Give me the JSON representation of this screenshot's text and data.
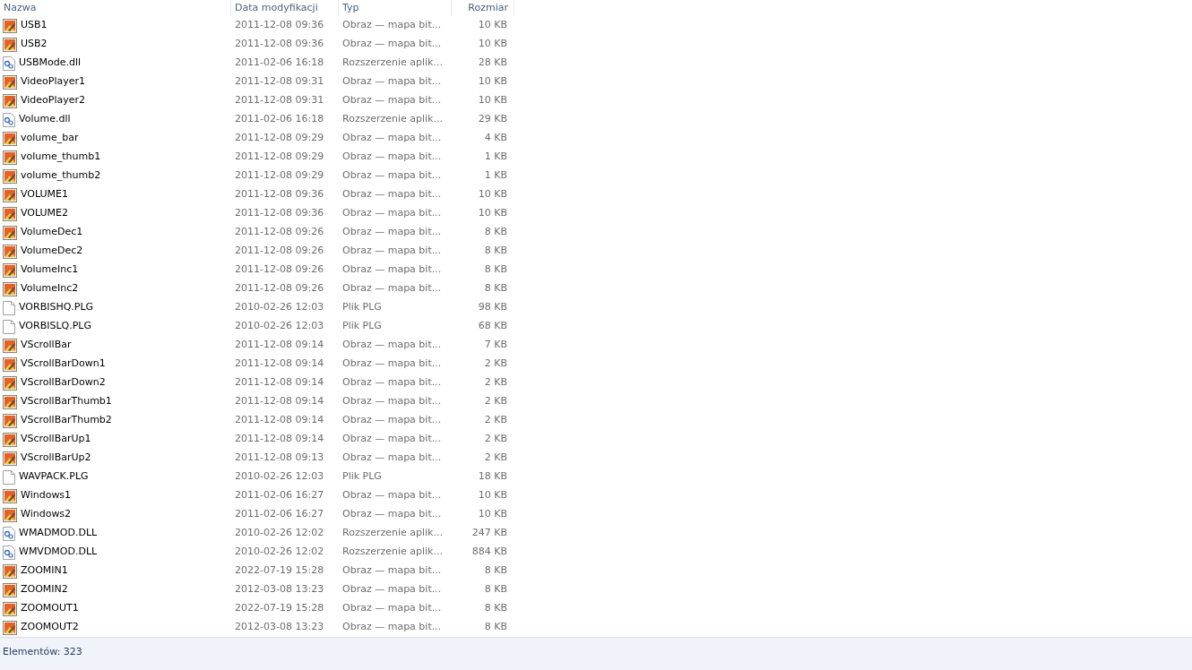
{
  "columns": [
    "Nazwa",
    "Data modyfikacji",
    "Typ",
    "Rozmiar"
  ],
  "files": [
    {
      "name": "USB1",
      "date": "2011-12-08 09:36",
      "type": "Obraz — mapa bit...",
      "size": "10 KB",
      "kind": "bitmap"
    },
    {
      "name": "USB2",
      "date": "2011-12-08 09:36",
      "type": "Obraz — mapa bit...",
      "size": "10 KB",
      "kind": "bitmap"
    },
    {
      "name": "USBMode.dll",
      "date": "2011-02-06 16:18",
      "type": "Rozszerzenie aplik...",
      "size": "28 KB",
      "kind": "dll"
    },
    {
      "name": "VideoPlayer1",
      "date": "2011-12-08 09:31",
      "type": "Obraz — mapa bit...",
      "size": "10 KB",
      "kind": "bitmap"
    },
    {
      "name": "VideoPlayer2",
      "date": "2011-12-08 09:31",
      "type": "Obraz — mapa bit...",
      "size": "10 KB",
      "kind": "bitmap"
    },
    {
      "name": "Volume.dll",
      "date": "2011-02-06 16:18",
      "type": "Rozszerzenie aplik...",
      "size": "29 KB",
      "kind": "dll"
    },
    {
      "name": "volume_bar",
      "date": "2011-12-08 09:29",
      "type": "Obraz — mapa bit...",
      "size": "4 KB",
      "kind": "bitmap"
    },
    {
      "name": "volume_thumb1",
      "date": "2011-12-08 09:29",
      "type": "Obraz — mapa bit...",
      "size": "1 KB",
      "kind": "bitmap"
    },
    {
      "name": "volume_thumb2",
      "date": "2011-12-08 09:29",
      "type": "Obraz — mapa bit...",
      "size": "1 KB",
      "kind": "bitmap"
    },
    {
      "name": "VOLUME1",
      "date": "2011-12-08 09:36",
      "type": "Obraz — mapa bit...",
      "size": "10 KB",
      "kind": "bitmap"
    },
    {
      "name": "VOLUME2",
      "date": "2011-12-08 09:36",
      "type": "Obraz — mapa bit...",
      "size": "10 KB",
      "kind": "bitmap"
    },
    {
      "name": "VolumeDec1",
      "date": "2011-12-08 09:26",
      "type": "Obraz — mapa bit...",
      "size": "8 KB",
      "kind": "bitmap"
    },
    {
      "name": "VolumeDec2",
      "date": "2011-12-08 09:26",
      "type": "Obraz — mapa bit...",
      "size": "8 KB",
      "kind": "bitmap"
    },
    {
      "name": "VolumeInc1",
      "date": "2011-12-08 09:26",
      "type": "Obraz — mapa bit...",
      "size": "8 KB",
      "kind": "bitmap"
    },
    {
      "name": "VolumeInc2",
      "date": "2011-12-08 09:26",
      "type": "Obraz — mapa bit...",
      "size": "8 KB",
      "kind": "bitmap"
    },
    {
      "name": "VORBISHQ.PLG",
      "date": "2010-02-26 12:03",
      "type": "Plik PLG",
      "size": "98 KB",
      "kind": "file"
    },
    {
      "name": "VORBISLQ.PLG",
      "date": "2010-02-26 12:03",
      "type": "Plik PLG",
      "size": "68 KB",
      "kind": "file"
    },
    {
      "name": "VScrollBar",
      "date": "2011-12-08 09:14",
      "type": "Obraz — mapa bit...",
      "size": "7 KB",
      "kind": "bitmap"
    },
    {
      "name": "VScrollBarDown1",
      "date": "2011-12-08 09:14",
      "type": "Obraz — mapa bit...",
      "size": "2 KB",
      "kind": "bitmap"
    },
    {
      "name": "VScrollBarDown2",
      "date": "2011-12-08 09:14",
      "type": "Obraz — mapa bit...",
      "size": "2 KB",
      "kind": "bitmap"
    },
    {
      "name": "VScrollBarThumb1",
      "date": "2011-12-08 09:14",
      "type": "Obraz — mapa bit...",
      "size": "2 KB",
      "kind": "bitmap"
    },
    {
      "name": "VScrollBarThumb2",
      "date": "2011-12-08 09:14",
      "type": "Obraz — mapa bit...",
      "size": "2 KB",
      "kind": "bitmap"
    },
    {
      "name": "VScrollBarUp1",
      "date": "2011-12-08 09:14",
      "type": "Obraz — mapa bit...",
      "size": "2 KB",
      "kind": "bitmap"
    },
    {
      "name": "VScrollBarUp2",
      "date": "2011-12-08 09:13",
      "type": "Obraz — mapa bit...",
      "size": "2 KB",
      "kind": "bitmap"
    },
    {
      "name": "WAVPACK.PLG",
      "date": "2010-02-26 12:03",
      "type": "Plik PLG",
      "size": "18 KB",
      "kind": "file"
    },
    {
      "name": "Windows1",
      "date": "2011-02-06 16:27",
      "type": "Obraz — mapa bit...",
      "size": "10 KB",
      "kind": "bitmap"
    },
    {
      "name": "Windows2",
      "date": "2011-02-06 16:27",
      "type": "Obraz — mapa bit...",
      "size": "10 KB",
      "kind": "bitmap"
    },
    {
      "name": "WMADMOD.DLL",
      "date": "2010-02-26 12:02",
      "type": "Rozszerzenie aplik...",
      "size": "247 KB",
      "kind": "dll"
    },
    {
      "name": "WMVDMOD.DLL",
      "date": "2010-02-26 12:02",
      "type": "Rozszerzenie aplik...",
      "size": "884 KB",
      "kind": "dll"
    },
    {
      "name": "ZOOMIN1",
      "date": "2022-07-19 15:28",
      "type": "Obraz — mapa bit...",
      "size": "8 KB",
      "kind": "bitmap"
    },
    {
      "name": "ZOOMIN2",
      "date": "2012-03-08 13:23",
      "type": "Obraz — mapa bit...",
      "size": "8 KB",
      "kind": "bitmap"
    },
    {
      "name": "ZOOMOUT1",
      "date": "2022-07-19 15:28",
      "type": "Obraz — mapa bit...",
      "size": "8 KB",
      "kind": "bitmap"
    },
    {
      "name": "ZOOMOUT2",
      "date": "2012-03-08 13:23",
      "type": "Obraz — mapa bit...",
      "size": "8 KB",
      "kind": "bitmap"
    }
  ],
  "status_bar": "Elementów: 323"
}
